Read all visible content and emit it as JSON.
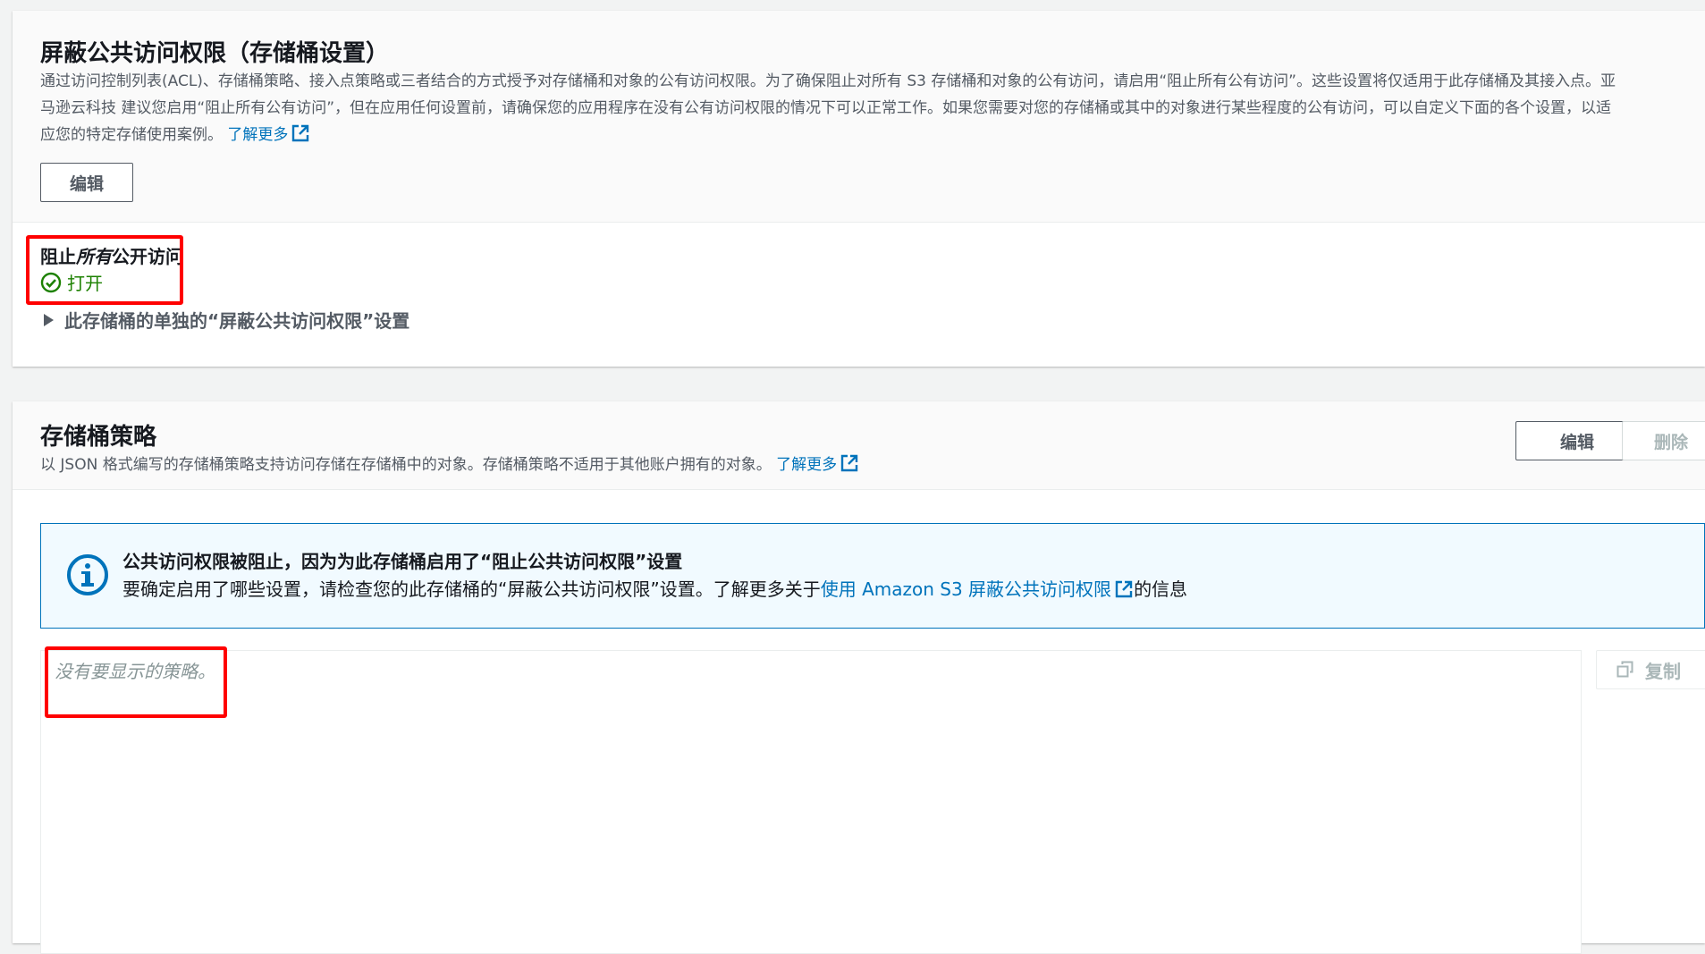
{
  "block_public_access": {
    "title": "屏蔽公共访问权限（存储桶设置）",
    "description_line1": "通过访问控制列表(ACL)、存储桶策略、接入点策略或三者结合的方式授予对存储桶和对象的公有访问权限。为了确保阻止对所有 S3 存储桶和对象的公有访问，请启用“阻止所有公有访问”。这些设置将仅适用于此存储桶及其接入点。亚",
    "description_line2": "马逊云科技 建议您启用“阻止所有公有访问”，但在应用任何设置前，请确保您的应用程序在没有公有访问权限的情况下可以正常工作。如果您需要对您的存储桶或其中的对象进行某些程度的公有访问，可以自定义下面的各个设置，以适",
    "description_line3": "应您的特定存储使用案例。",
    "learn_more": "了解更多",
    "edit_label": "编辑",
    "status_label_prefix": "阻止",
    "status_label_emphasis": "所有",
    "status_label_suffix": "公开访问",
    "status_value": "打开",
    "expander_label": "此存储桶的单独的“屏蔽公共访问权限”设置"
  },
  "bucket_policy": {
    "title": "存储桶策略",
    "description": "以 JSON 格式编写的存储桶策略支持访问存储在存储桶中的对象。存储桶策略不适用于其他账户拥有的对象。",
    "learn_more": "了解更多",
    "edit_label": "编辑",
    "delete_label": "删除",
    "alert_title": "公共访问权限被阻止，因为为此存储桶启用了“阻止公共访问权限”设置",
    "alert_body_prefix": "要确定启用了哪些设置，请检查您的此存储桶的“屏蔽公共访问权限”设置。了解更多关于",
    "alert_link": "使用 Amazon S3 屏蔽公共访问权限",
    "alert_body_suffix": "的信息",
    "policy_placeholder": "没有要显示的策略。",
    "copy_label": "复制"
  },
  "colors": {
    "link": "#0073bb",
    "success": "#1d8102",
    "highlight": "#ff0000",
    "info_bg": "#f1faff"
  }
}
